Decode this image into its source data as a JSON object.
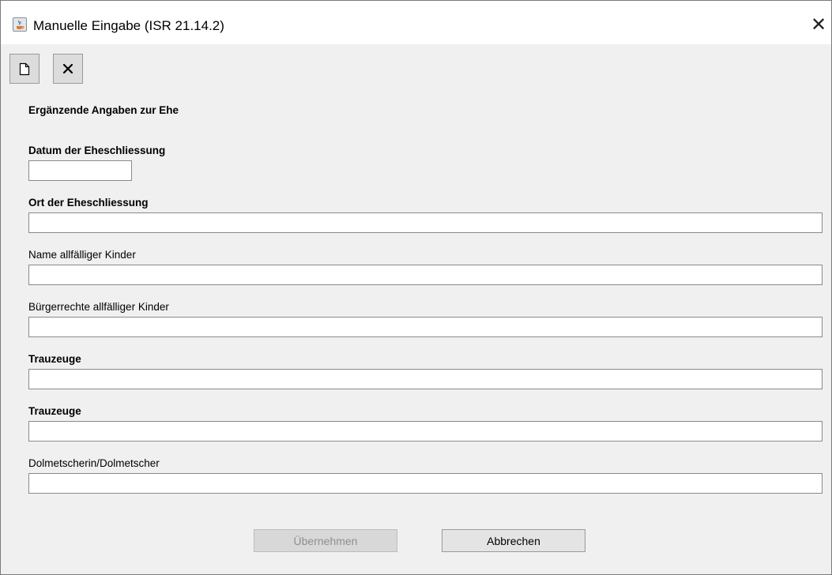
{
  "window": {
    "title": "Manuelle Eingabe (ISR 21.14.2)",
    "close_glyph": "✕"
  },
  "toolbar": {
    "new_icon": "new-document-icon",
    "delete_icon": "delete-x-icon",
    "delete_glyph": "✕"
  },
  "section": {
    "heading": "Ergänzende Angaben zur Ehe"
  },
  "fields": {
    "marriage_date": {
      "label": "Datum der Eheschliessung",
      "value": ""
    },
    "marriage_place": {
      "label": "Ort der Eheschliessung",
      "value": ""
    },
    "children_names": {
      "label": "Name allfälliger Kinder",
      "value": ""
    },
    "children_citizenship": {
      "label": "Bürgerrechte allfälliger Kinder",
      "value": ""
    },
    "witness_1": {
      "label": "Trauzeuge",
      "value": ""
    },
    "witness_2": {
      "label": "Trauzeuge",
      "value": ""
    },
    "interpreter": {
      "label": "Dolmetscherin/Dolmetscher",
      "value": ""
    }
  },
  "buttons": {
    "apply_label": "Übernehmen",
    "apply_enabled": false,
    "cancel_label": "Abbrechen"
  }
}
